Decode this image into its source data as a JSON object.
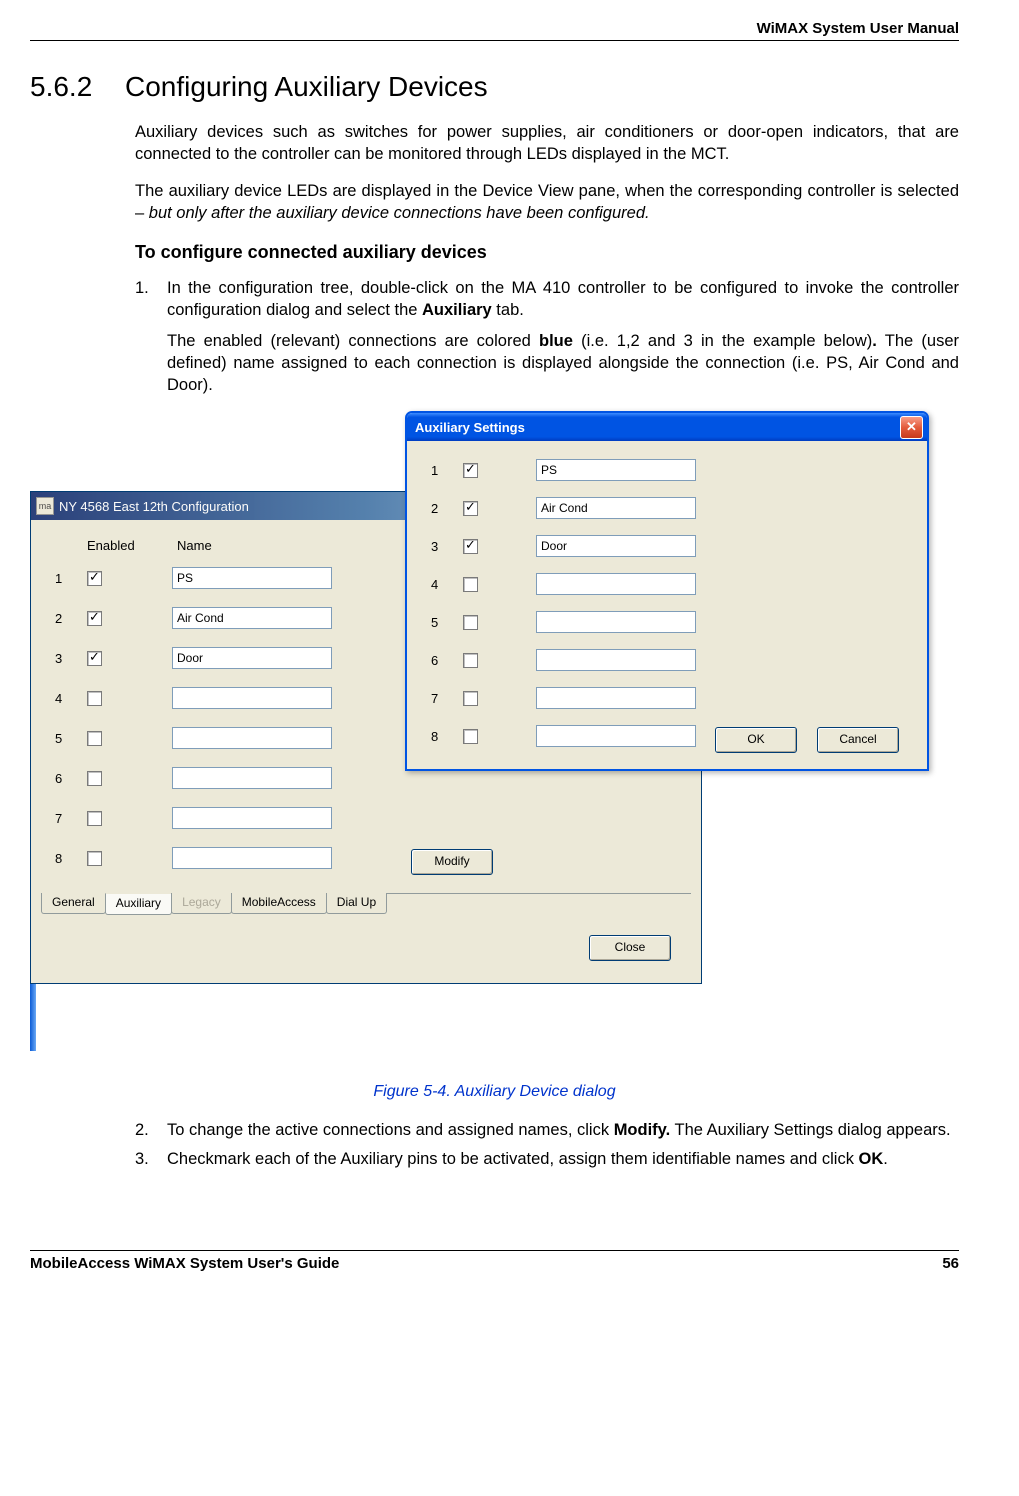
{
  "header": {
    "doc_title": "WiMAX System User Manual"
  },
  "section": {
    "number": "5.6.2",
    "title": "Configuring Auxiliary Devices",
    "para1": "Auxiliary devices such as switches for power supplies, air conditioners or door-open indicators, that are connected to the controller can be monitored through LEDs displayed in the MCT.",
    "para2_a": "The auxiliary device LEDs are displayed in the Device View pane, when the corresponding controller is selected – ",
    "para2_b": "but only after the auxiliary device connections have been configured.",
    "subhead": "To configure connected auxiliary devices",
    "step1_num": "1.",
    "step1_a": "In the configuration tree, double-click on the MA 410 controller to be configured to invoke the controller configuration dialog and select the ",
    "step1_b": "Auxiliary",
    "step1_c": " tab.",
    "step1_sub_a": "The enabled (relevant) connections are colored ",
    "step1_sub_b": "blue",
    "step1_sub_c": " (i.e. 1,2 and 3 in the example below)",
    "step1_sub_d": ".",
    "step1_sub_e": " The (user defined) name assigned to each connection is displayed alongside the connection (i.e. PS, Air Cond and Door).",
    "caption": "Figure 5-4. Auxiliary Device dialog",
    "step2_num": "2.",
    "step2_a": "To change the active connections and assigned names, click ",
    "step2_b": "Modify.",
    "step2_c": " The Auxiliary Settings dialog appears.",
    "step3_num": "3.",
    "step3_a": "Checkmark each of the Auxiliary pins to be activated, assign them identifiable names and click ",
    "step3_b": "OK",
    "step3_c": "."
  },
  "config_dialog": {
    "icon": "ma",
    "title": "NY 4568 East 12th Configuration",
    "col_enabled": "Enabled",
    "col_name": "Name",
    "rows": [
      {
        "n": "1",
        "checked": true,
        "name": "PS"
      },
      {
        "n": "2",
        "checked": true,
        "name": "Air Cond"
      },
      {
        "n": "3",
        "checked": true,
        "name": "Door"
      },
      {
        "n": "4",
        "checked": false,
        "name": ""
      },
      {
        "n": "5",
        "checked": false,
        "name": ""
      },
      {
        "n": "6",
        "checked": false,
        "name": ""
      },
      {
        "n": "7",
        "checked": false,
        "name": ""
      },
      {
        "n": "8",
        "checked": false,
        "name": ""
      }
    ],
    "modify_btn": "Modify",
    "tabs": [
      "General",
      "Auxiliary",
      "Legacy",
      "MobileAccess",
      "Dial Up"
    ],
    "active_tab": 1,
    "disabled_tab": 2,
    "close_btn": "Close"
  },
  "aux_dialog": {
    "title": "Auxiliary Settings",
    "rows": [
      {
        "n": "1",
        "checked": true,
        "name": "PS"
      },
      {
        "n": "2",
        "checked": true,
        "name": "Air Cond"
      },
      {
        "n": "3",
        "checked": true,
        "name": "Door"
      },
      {
        "n": "4",
        "checked": false,
        "name": ""
      },
      {
        "n": "5",
        "checked": false,
        "name": ""
      },
      {
        "n": "6",
        "checked": false,
        "name": ""
      },
      {
        "n": "7",
        "checked": false,
        "name": ""
      },
      {
        "n": "8",
        "checked": false,
        "name": ""
      }
    ],
    "ok_btn": "OK",
    "cancel_btn": "Cancel"
  },
  "footer": {
    "left": "MobileAccess WiMAX System User's Guide",
    "right": "56"
  }
}
